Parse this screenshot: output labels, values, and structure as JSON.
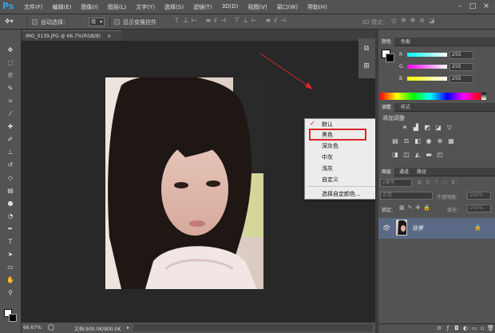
{
  "app": {
    "logo": "Ps"
  },
  "menubar": {
    "items": [
      "文件(F)",
      "编辑(E)",
      "图像(I)",
      "图层(L)",
      "文字(Y)",
      "选择(S)",
      "滤镜(T)",
      "3D(D)",
      "视图(V)",
      "窗口(W)",
      "帮助(H)"
    ],
    "window_buttons": [
      "–",
      "□",
      "×"
    ]
  },
  "options_bar": {
    "auto_select_label": "自动选择：",
    "auto_select_value": "组",
    "show_transform_label": "显示变换控件",
    "mode_3d_label": "3D 模式："
  },
  "document": {
    "tab_label": "IMG_0139.JPG @ 66.7%(RGB/8)",
    "tab_close": "×"
  },
  "context_menu": {
    "items": [
      "默认",
      "黑色",
      "深灰色",
      "中灰",
      "浅灰",
      "自定义",
      "选择自定颜色..."
    ],
    "checked_index": 0,
    "highlighted_index": 1
  },
  "status_bar": {
    "zoom": "66.67%",
    "doc_size": "文档:900.0K/900.0K"
  },
  "color_panel": {
    "tabs": [
      "颜色",
      "色板"
    ],
    "channels": [
      {
        "label": "R",
        "value": "255"
      },
      {
        "label": "G",
        "value": "255"
      },
      {
        "label": "B",
        "value": "255"
      }
    ]
  },
  "adjustments_panel": {
    "tabs": [
      "调整",
      "样式"
    ],
    "title": "添加调整"
  },
  "layers_panel": {
    "tabs": [
      "图层",
      "通道",
      "路径"
    ],
    "kind_label": "ρ类型",
    "blend_mode": "正常",
    "opacity_label": "不透明度:",
    "opacity_value": "100%",
    "lock_label": "锁定:",
    "fill_label": "填充:",
    "fill_value": "100%",
    "layer_name": "背景"
  },
  "colors": {
    "menubar_bg": "#535353",
    "canvas_bg": "#282828",
    "layer_selected": "#5a6a86",
    "highlight_red": "#d9262a",
    "annotation_arrow": "#d9262a"
  }
}
